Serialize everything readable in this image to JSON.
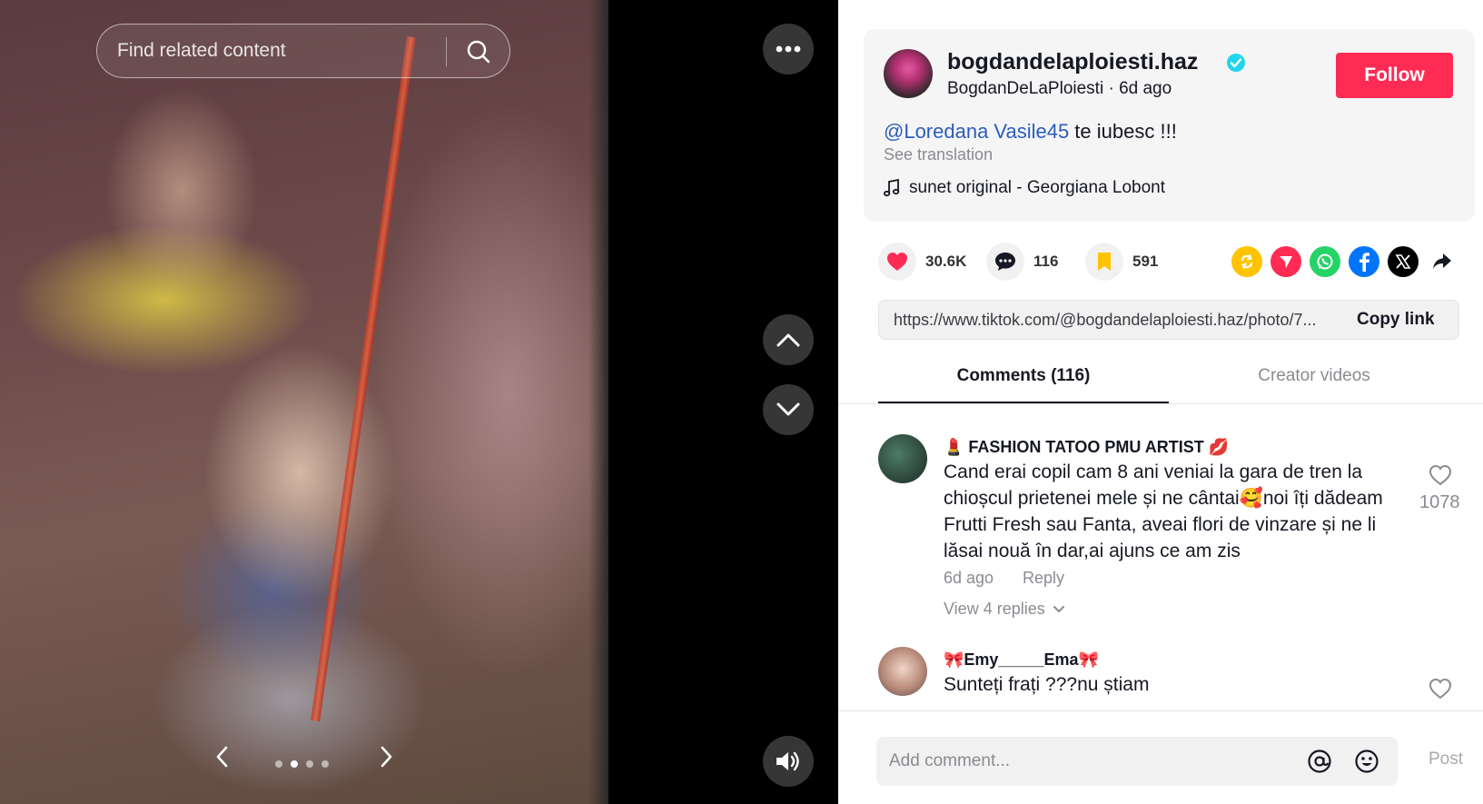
{
  "search": {
    "placeholder": "Find related content"
  },
  "carousel": {
    "total": 4,
    "active": 2
  },
  "author": {
    "username": "bogdandelaploiesti.haz",
    "nickname": "BogdanDeLaPloiesti",
    "separator": " · ",
    "posted": "6d ago",
    "follow_label": "Follow"
  },
  "caption": {
    "mention": "@Loredana Vasile45",
    "text": " te iubesc !!!",
    "see_translation": "See translation"
  },
  "music": {
    "title": "sunet original - Georgiana Lobont"
  },
  "stats": {
    "likes": "30.6K",
    "comments": "116",
    "saves": "591"
  },
  "share": {
    "icons": [
      "repost-icon",
      "send-icon",
      "whatsapp-icon",
      "facebook-icon",
      "x-icon",
      "share-arrow-icon"
    ],
    "colors": {
      "repost": "#ffc300",
      "send": "#fe2c55",
      "whatsapp": "#25d366",
      "facebook": "#0075fa",
      "x": "#000000"
    }
  },
  "link": {
    "url": "https://www.tiktok.com/@bogdandelaploiesti.haz/photo/7...",
    "copy_label": "Copy link"
  },
  "tabs": {
    "comments": "Comments (116)",
    "creator": "Creator videos"
  },
  "comments": [
    {
      "author": "💄 FASHION TATOO PMU ARTIST 💋",
      "text": "Cand erai copil cam 8 ani veniai la gara de tren la chioșcul prietenei mele și ne cântai🥰noi îți dădeam Frutti Fresh sau Fanta, aveai flori de vinzare și ne li lăsai nouă în dar,ai ajuns ce am zis",
      "time": "6d ago",
      "reply_label": "Reply",
      "view_replies": "View 4 replies",
      "likes": "1078"
    },
    {
      "author": "🎀Emy_____Ema🎀",
      "text": "Sunteți frați ???nu știam",
      "likes": ""
    }
  ],
  "composer": {
    "placeholder": "Add comment...",
    "post_label": "Post"
  },
  "colors": {
    "accent": "#fe2c55",
    "mention": "#2b5db9",
    "verified": "#20d5ec"
  }
}
